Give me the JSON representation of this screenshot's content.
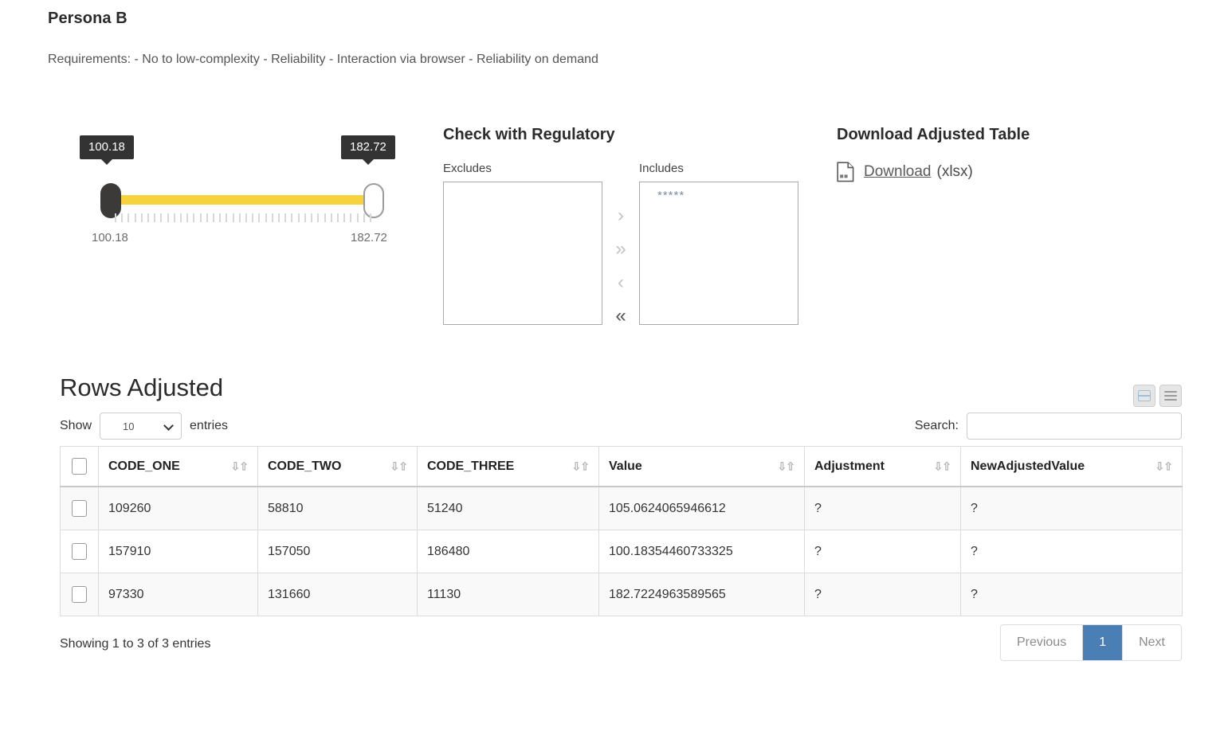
{
  "persona": {
    "title": "Persona B",
    "requirements": "Requirements: - No to low-complexity - Reliability - Interaction via browser - Reliability on demand"
  },
  "slider": {
    "min_tooltip": "100.18",
    "max_tooltip": "182.72",
    "min_label": "100.18",
    "max_label": "182.72",
    "track_color": "#f6d23f",
    "tooltip_bg": "#333333"
  },
  "regulatory": {
    "heading": "Check with Regulatory",
    "excludes_label": "Excludes",
    "includes_label": "Includes",
    "excludes_options": [],
    "includes_options": [
      "*****"
    ],
    "arrows": [
      {
        "glyph": "›",
        "name": "move-right-icon",
        "emphasis": "light"
      },
      {
        "glyph": "»",
        "name": "move-all-right-icon",
        "emphasis": "light"
      },
      {
        "glyph": "‹",
        "name": "move-left-icon",
        "emphasis": "light"
      },
      {
        "glyph": "«",
        "name": "move-all-left-icon",
        "emphasis": "dark"
      }
    ]
  },
  "download": {
    "heading": "Download Adjusted Table",
    "link_label": "Download",
    "extension": "(xlsx)",
    "icon": "xlsx-file-icon"
  },
  "table_panel": {
    "title": "Rows Adjusted",
    "show_label": "Show",
    "entries_value": "10",
    "entries_label": "entries",
    "search_label": "Search:",
    "search_value": "",
    "search_placeholder": "",
    "view_toggle_1": "split-view-icon",
    "view_toggle_2": "list-view-icon",
    "columns": [
      "CODE_ONE",
      "CODE_TWO",
      "CODE_THREE",
      "Value",
      "Adjustment",
      "NewAdjustedValue"
    ],
    "rows": [
      {
        "code_one": "109260",
        "code_two": "58810",
        "code_three": "51240",
        "value": "105.0624065946612",
        "adjustment": "?",
        "new_adjusted_value": "?"
      },
      {
        "code_one": "157910",
        "code_two": "157050",
        "code_three": "186480",
        "value": "100.18354460733325",
        "adjustment": "?",
        "new_adjusted_value": "?"
      },
      {
        "code_one": "97330",
        "code_two": "131660",
        "code_three": "11130",
        "value": "182.7224963589565",
        "adjustment": "?",
        "new_adjusted_value": "?"
      }
    ],
    "showing_info": "Showing 1 to 3 of 3 entries",
    "pagination": {
      "previous": "Previous",
      "current_page": "1",
      "next": "Next",
      "active_color": "#4a7fb5"
    },
    "unknown_marker_color": "#d9786b"
  }
}
